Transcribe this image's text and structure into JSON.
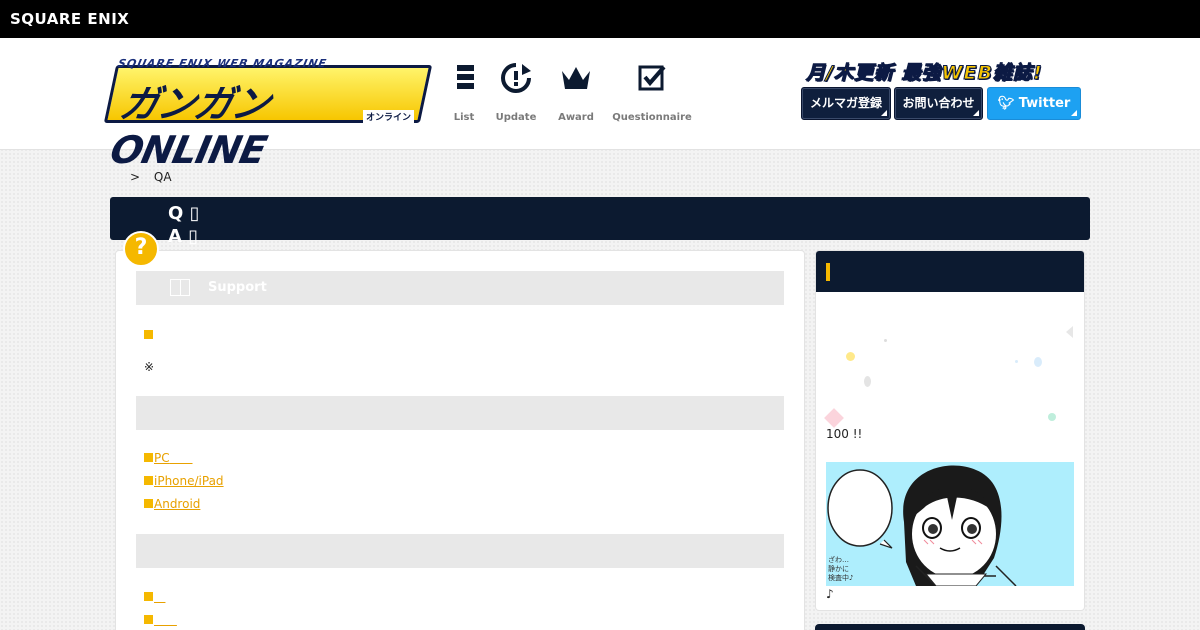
{
  "brand": {
    "name": "SQUARE ENIX"
  },
  "logo": {
    "subtitle": "SQUARE ENIX WEB MAGAZINE",
    "title": "ガンガンONLINE",
    "kana": "オンライン"
  },
  "nav": [
    {
      "label": "List",
      "icon": "list-icon"
    },
    {
      "label": "Update",
      "icon": "update-icon"
    },
    {
      "label": "Award",
      "icon": "crown-icon"
    },
    {
      "label": "Questionnaire",
      "icon": "checkbox-icon"
    }
  ],
  "header": {
    "tagline": "月/木更新 最強WEB雑誌!",
    "newsletter_label": "メルマガ登録",
    "contact_label": "お問い合わせ",
    "twitter_label": "Twitter"
  },
  "breadcrumb": {
    "separator": ">",
    "current": "QA"
  },
  "title": {
    "line1": "Q",
    "line2": "A",
    "badge": "?"
  },
  "main": {
    "sections": [
      {
        "title": "Support",
        "links": [
          ""
        ],
        "note": "※"
      },
      {
        "title": "",
        "links": [
          "PC",
          "iPhone/iPad",
          "Android"
        ]
      },
      {
        "title": "",
        "links": [
          "",
          ""
        ]
      }
    ]
  },
  "side": {
    "text": "100 !!",
    "note": "♪",
    "manga_caption": "ざわ… 静かに 検査中♪"
  },
  "colors": {
    "navy": "#0c1a30",
    "accent": "#f5b800",
    "link": "#e8a100",
    "twitter": "#1da1f2"
  }
}
